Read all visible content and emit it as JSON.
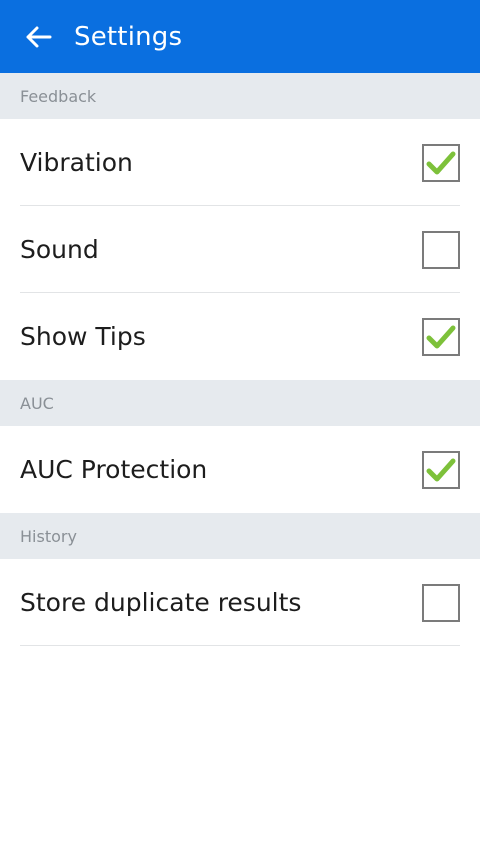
{
  "appbar": {
    "title": "Settings",
    "back_icon": "arrow-left-icon",
    "color": "#0a6fe0"
  },
  "sections": {
    "feedback": {
      "header": "Feedback",
      "items": [
        {
          "label": "Vibration",
          "checked": true
        },
        {
          "label": "Sound",
          "checked": false
        },
        {
          "label": "Show Tips",
          "checked": true
        }
      ]
    },
    "auc": {
      "header": "AUC",
      "items": [
        {
          "label": "AUC Protection",
          "checked": true
        }
      ]
    },
    "history": {
      "header": "History",
      "items": [
        {
          "label": "Store duplicate results",
          "checked": false
        }
      ]
    }
  },
  "colors": {
    "check": "#7dc13a",
    "section_bg": "#e6eaee"
  }
}
